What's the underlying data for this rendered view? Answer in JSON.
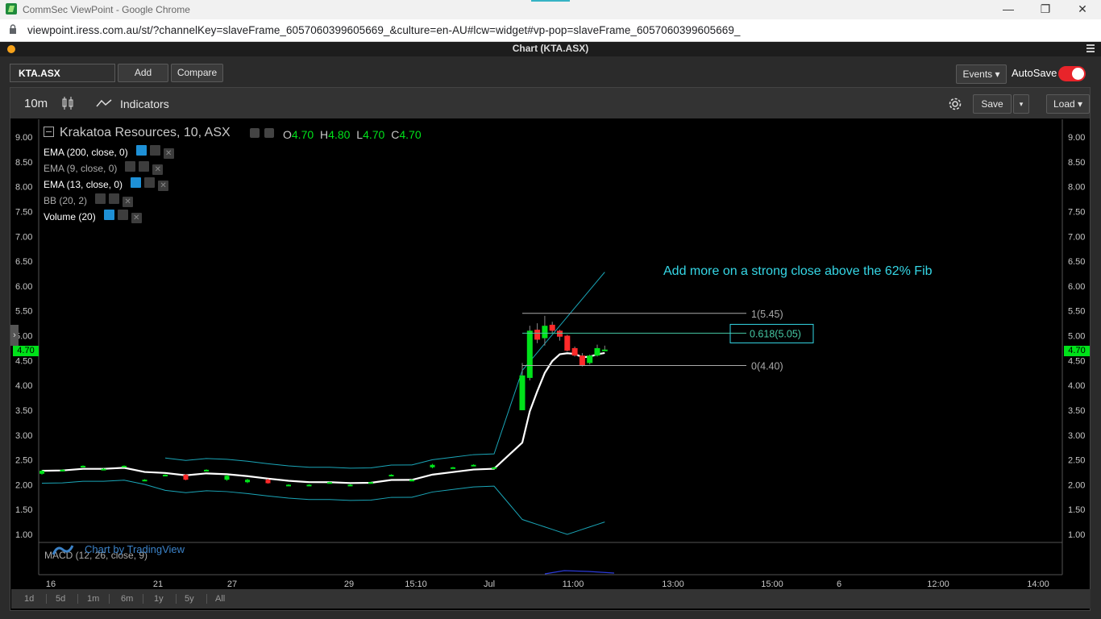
{
  "browser": {
    "title": "CommSec ViewPoint - Google Chrome",
    "url": "viewpoint.iress.com.au/st/?channelKey=slaveFrame_6057060399605669_&culture=en-AU#lcw=widget#vp-pop=slaveFrame_6057060399605669_",
    "minimize": "—",
    "restore": "❐",
    "close": "✕"
  },
  "panel": {
    "title": "Chart (KTA.ASX)"
  },
  "toolbar": {
    "symbol": "KTA.ASX",
    "add_label": "Add",
    "compare_label": "Compare",
    "events_label": "Events ▾",
    "autosave_label": "AutoSave",
    "autosave_on": true
  },
  "chart_header": {
    "interval": "10m",
    "indicators_label": "Indicators",
    "save_label": "Save",
    "save_caret": "▾",
    "load_label": "Load ▾"
  },
  "legend": {
    "symbol_title": "Krakatoa Resources, 10, ASX",
    "ohlc": {
      "o_label": "O",
      "o": "4.70",
      "h_label": "H",
      "h": "4.80",
      "l_label": "L",
      "l": "4.70",
      "c_label": "C",
      "c": "4.70"
    },
    "studies": [
      {
        "label": "EMA (200, close, 0)",
        "bright": true
      },
      {
        "label": "EMA (9, close, 0)",
        "bright": false
      },
      {
        "label": "EMA (13, close, 0)",
        "bright": true
      },
      {
        "label": "BB (20, 2)",
        "bright": false
      },
      {
        "label": "Volume (20)",
        "bright": true
      }
    ]
  },
  "annotation": "Add more on a strong close above the 62% Fib",
  "macd_label": "MACD (12, 26, close, 9)",
  "watermark": "Chart by TradingView",
  "price_tag": "4.70",
  "side_handle": "›",
  "time_ranges": [
    "1d",
    "5d",
    "1m",
    "6m",
    "1y",
    "5y",
    "All"
  ],
  "colors": {
    "up": "#00e21a",
    "down": "#ff2a2a",
    "bb": "#1aa6b8",
    "ema": "#ffffff",
    "annotation": "#35d7e6",
    "fib_mid": "#46c8a4",
    "autosave": "#e8242a"
  },
  "chart_data": {
    "type": "candlestick",
    "ylim": [
      0.85,
      9.2
    ],
    "y_ticks": [
      "9.00",
      "8.50",
      "8.00",
      "7.50",
      "7.00",
      "6.50",
      "6.00",
      "5.50",
      "5.00",
      "4.50",
      "4.00",
      "3.50",
      "3.00",
      "2.50",
      "2.00",
      "1.50",
      "1.00"
    ],
    "x_tick_labels": [
      "16",
      "21",
      "27",
      "29",
      "15:10",
      "Jul",
      "11:00",
      "13:00",
      "15:00",
      "6",
      "12:00",
      "14:00"
    ],
    "candles": [
      {
        "o": 2.22,
        "c": 2.28,
        "h": 2.3,
        "l": 2.2
      },
      {
        "o": 2.3,
        "c": 2.3,
        "h": 2.31,
        "l": 2.29
      },
      {
        "o": 2.38,
        "c": 2.38,
        "h": 2.39,
        "l": 2.37
      },
      {
        "o": 2.32,
        "c": 2.32,
        "h": 2.33,
        "l": 2.31
      },
      {
        "o": 2.38,
        "c": 2.38,
        "h": 2.39,
        "l": 2.37
      },
      {
        "o": 2.1,
        "c": 2.1,
        "h": 2.11,
        "l": 2.09
      },
      {
        "o": 2.2,
        "c": 2.2,
        "h": 2.21,
        "l": 2.19
      },
      {
        "o": 2.2,
        "c": 2.1,
        "h": 2.21,
        "l": 2.09
      },
      {
        "o": 2.3,
        "c": 2.3,
        "h": 2.31,
        "l": 2.29
      },
      {
        "o": 2.1,
        "c": 2.18,
        "h": 2.2,
        "l": 2.08
      },
      {
        "o": 2.05,
        "c": 2.1,
        "h": 2.12,
        "l": 2.03
      },
      {
        "o": 2.1,
        "c": 2.03,
        "h": 2.12,
        "l": 2.02
      },
      {
        "o": 2.0,
        "c": 2.0,
        "h": 2.01,
        "l": 1.99
      },
      {
        "o": 2.0,
        "c": 2.0,
        "h": 2.01,
        "l": 1.99
      },
      {
        "o": 2.05,
        "c": 2.05,
        "h": 2.06,
        "l": 2.04
      },
      {
        "o": 2.0,
        "c": 2.0,
        "h": 2.01,
        "l": 1.99
      },
      {
        "o": 2.05,
        "c": 2.05,
        "h": 2.06,
        "l": 2.04
      },
      {
        "o": 2.2,
        "c": 2.2,
        "h": 2.21,
        "l": 2.19
      },
      {
        "o": 2.1,
        "c": 2.1,
        "h": 2.11,
        "l": 2.09
      },
      {
        "o": 2.35,
        "c": 2.4,
        "h": 2.42,
        "l": 2.33
      },
      {
        "o": 2.35,
        "c": 2.35,
        "h": 2.36,
        "l": 2.34
      },
      {
        "o": 2.4,
        "c": 2.4,
        "h": 2.41,
        "l": 2.39
      },
      {
        "o": 2.35,
        "c": 2.35,
        "h": 2.36,
        "l": 2.34
      },
      {
        "o": 3.5,
        "c": 4.2,
        "h": 4.45,
        "l": 3.5
      },
      {
        "o": 4.15,
        "c": 5.1,
        "h": 5.2,
        "l": 4.1
      },
      {
        "o": 5.12,
        "c": 4.92,
        "h": 5.25,
        "l": 4.85
      },
      {
        "o": 4.95,
        "c": 5.2,
        "h": 5.4,
        "l": 4.8
      },
      {
        "o": 5.22,
        "c": 5.1,
        "h": 5.28,
        "l": 5.05
      },
      {
        "o": 5.1,
        "c": 4.98,
        "h": 5.12,
        "l": 4.9
      },
      {
        "o": 5.0,
        "c": 4.7,
        "h": 5.02,
        "l": 4.68
      },
      {
        "o": 4.75,
        "c": 4.6,
        "h": 4.78,
        "l": 4.58
      },
      {
        "o": 4.6,
        "c": 4.4,
        "h": 4.65,
        "l": 4.38
      },
      {
        "o": 4.45,
        "c": 4.6,
        "h": 4.62,
        "l": 4.42
      },
      {
        "o": 4.6,
        "c": 4.75,
        "h": 4.82,
        "l": 4.58
      },
      {
        "o": 4.72,
        "c": 4.72,
        "h": 4.8,
        "l": 4.7
      }
    ],
    "fib_levels": [
      {
        "label": "1(5.45)",
        "price": 5.45
      },
      {
        "label": "0.618(5.05)",
        "price": 5.05
      },
      {
        "label": "0(4.40)",
        "price": 4.4
      }
    ]
  }
}
